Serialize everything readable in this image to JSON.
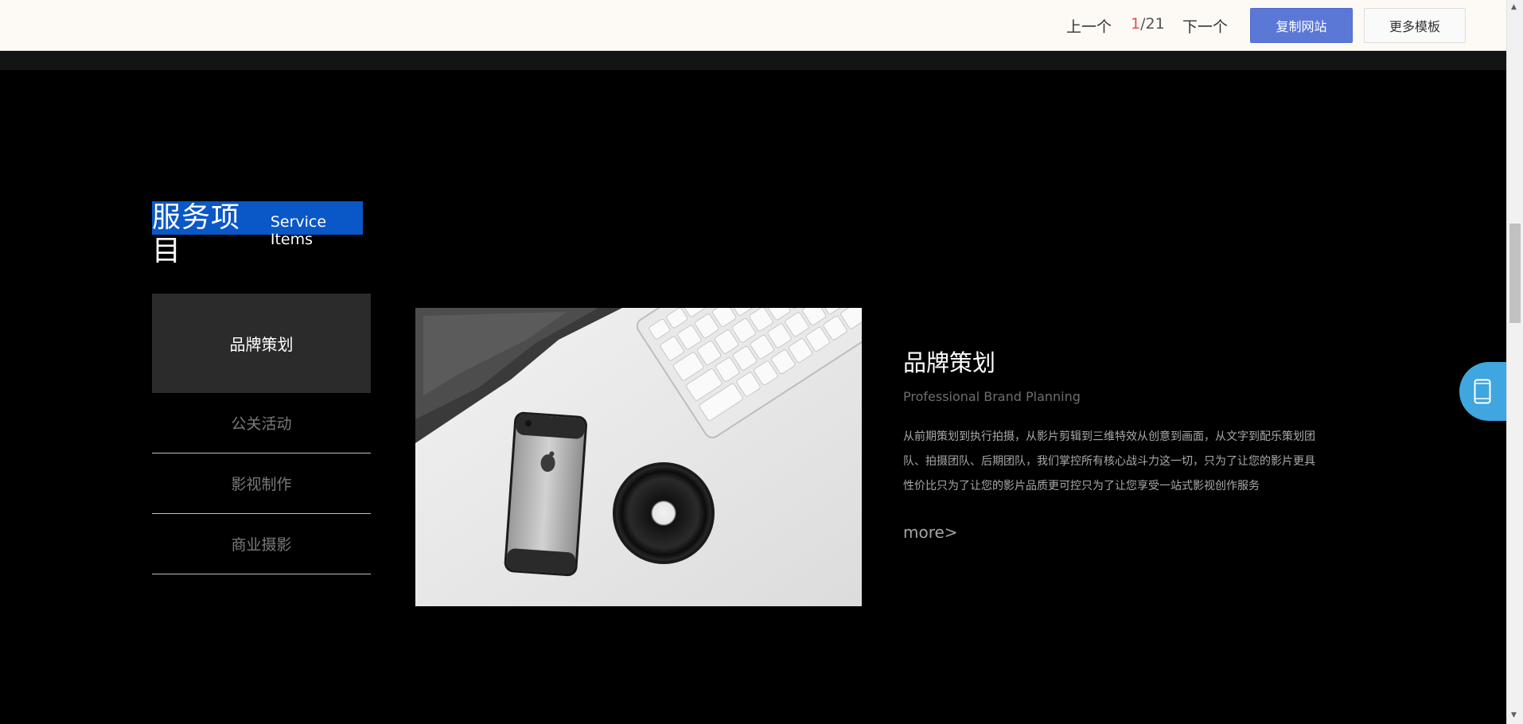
{
  "topbar": {
    "prev_label": "上一个",
    "counter_current": "1",
    "counter_total": "/21",
    "next_label": "下一个",
    "copy_site_label": "复制网站",
    "more_templates_label": "更多模板"
  },
  "section": {
    "title_cn": "服务项目",
    "title_en": "Service Items"
  },
  "tabs": [
    {
      "label": "品牌策划",
      "active": true
    },
    {
      "label": "公关活动",
      "active": false
    },
    {
      "label": "影视制作",
      "active": false
    },
    {
      "label": "商业摄影",
      "active": false
    }
  ],
  "detail": {
    "title": "品牌策划",
    "subtitle": "Professional Brand Planning",
    "body": "从前期策划到执行拍摄，从影片剪辑到三维特效从创意到画面，从文字到配乐策划团队、拍摄团队、后期团队，我们掌控所有核心战斗力这一切，只为了让您的影片更具性价比只为了让您的影片品质更可控只为了让您享受一站式影视创作服务",
    "more_label": "more>"
  },
  "icons": {
    "float_button": "mobile-phone-icon",
    "photo": "product-photo-iphone-keyboard-lens"
  },
  "colors": {
    "accent": "#5b78d6",
    "highlight": "#0a57c7",
    "float": "#3fa6df",
    "counter_current": "#e05050"
  }
}
